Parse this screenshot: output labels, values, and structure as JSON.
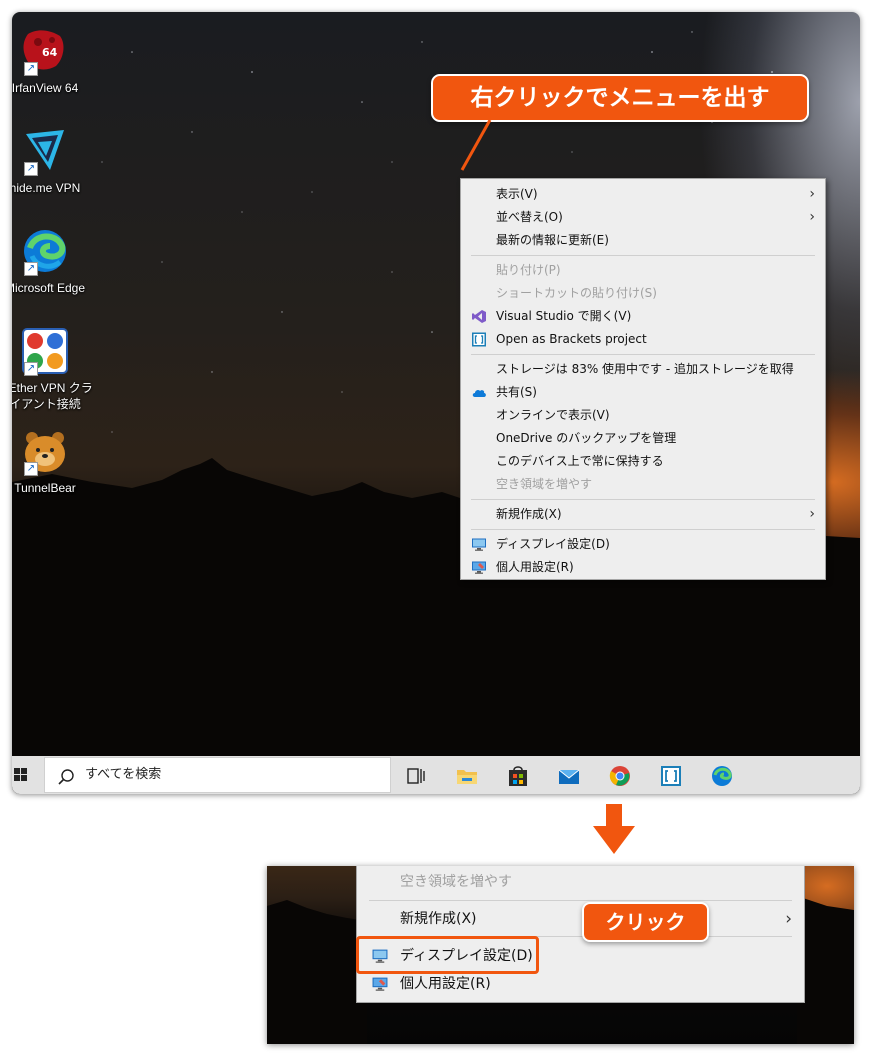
{
  "desktop": {
    "icons": [
      {
        "label": "IrfanView 64",
        "badge": "64",
        "icon": "irfanview-icon"
      },
      {
        "label": "hide.me VPN",
        "icon": "hideme-vpn-icon"
      },
      {
        "label": "Microsoft Edge",
        "icon": "edge-icon"
      },
      {
        "label_line1": "ftEther VPN クラ",
        "label_line2": "イアント接続",
        "icon": "softether-vpn-icon"
      },
      {
        "label": "TunnelBear",
        "icon": "tunnelbear-icon"
      }
    ],
    "callout": "右クリックでメニューを出す"
  },
  "context_menu": {
    "items": [
      {
        "label": "表示(V)",
        "submenu": true
      },
      {
        "label": "並べ替え(O)",
        "submenu": true
      },
      {
        "label": "最新の情報に更新(E)"
      },
      {
        "label": "貼り付け(P)",
        "disabled": true
      },
      {
        "label": "ショートカットの貼り付け(S)",
        "disabled": true
      },
      {
        "label": "Visual Studio で開く(V)",
        "icon": "visual-studio-icon"
      },
      {
        "label": "Open as Brackets project",
        "icon": "brackets-icon"
      },
      {
        "label": "ストレージは 83% 使用中です - 追加ストレージを取得"
      },
      {
        "label": "共有(S)",
        "icon": "onedrive-cloud-icon"
      },
      {
        "label": "オンラインで表示(V)"
      },
      {
        "label": "OneDrive のバックアップを管理"
      },
      {
        "label": "このデバイス上で常に保持する"
      },
      {
        "label": "空き領域を増やす",
        "disabled": true
      },
      {
        "label": "新規作成(X)",
        "submenu": true
      },
      {
        "label": "ディスプレイ設定(D)",
        "icon": "display-settings-icon"
      },
      {
        "label": "個人用設定(R)",
        "icon": "personalize-icon"
      }
    ]
  },
  "taskbar": {
    "search_placeholder": "すべてを検索",
    "icons": [
      "task-view-icon",
      "file-explorer-icon",
      "store-icon",
      "mail-icon",
      "chrome-icon",
      "brackets-icon",
      "edge-icon"
    ]
  },
  "zoom": {
    "items": [
      {
        "label": "空き領域を増やす",
        "disabled": true
      },
      {
        "label": "新規作成(X)",
        "submenu": true
      },
      {
        "label": "ディスプレイ設定(D)",
        "icon": "display-settings-icon"
      },
      {
        "label": "個人用設定(R)",
        "icon": "personalize-icon"
      }
    ],
    "callout": "クリック"
  },
  "colors": {
    "accent": "#f1560f",
    "menu_bg": "#eeeeee",
    "taskbar_bg": "#e2e2e2"
  }
}
